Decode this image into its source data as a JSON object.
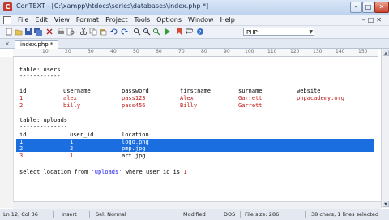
{
  "window": {
    "title": "ConTEXT - [C:\\xampp\\htdocs\\series\\databases\\index.php *]",
    "minimize": "–",
    "maximize": "□",
    "close": "✕"
  },
  "menu": {
    "items": [
      "File",
      "Edit",
      "View",
      "Format",
      "Project",
      "Tools",
      "Options",
      "Window",
      "Help"
    ],
    "right_controls": "–□✕"
  },
  "toolbar": {
    "highlighter": "PHP",
    "icons": [
      "new-file-icon",
      "open-icon",
      "save-icon",
      "save-all-icon",
      "close-file-icon",
      "print-icon",
      "print-preview-icon",
      "cut-icon",
      "copy-icon",
      "paste-icon",
      "undo-icon",
      "redo-icon",
      "find-icon",
      "replace-icon",
      "find-next-icon",
      "run-icon",
      "bookmark-icon",
      "wrap-icon",
      "help-icon"
    ]
  },
  "tabs": [
    {
      "label": "index.php *"
    }
  ],
  "tab_close": "×",
  "ruler": {
    "marks": [
      "10",
      "20",
      "30",
      "40",
      "50",
      "60",
      "70",
      "80",
      "90",
      "100",
      "110",
      "120",
      "130",
      "140",
      "150"
    ]
  },
  "code": {
    "users_title": "table: users",
    "dashes1": "------------",
    "users_headers": [
      "id",
      "username",
      "password",
      "firstname",
      "surname",
      "website"
    ],
    "users_rows": [
      [
        "1",
        "alex",
        "pass123",
        "Alex",
        "Garrett",
        "phpacademy.org"
      ],
      [
        "2",
        "billy",
        "pass456",
        "Billy",
        "Garrett",
        ""
      ]
    ],
    "uploads_title": "table: uploads",
    "dashes2": "--------------",
    "uploads_headers": [
      "id",
      "user_id",
      "location"
    ],
    "uploads_rows": [
      [
        "1",
        "1",
        "logo.png"
      ],
      [
        "2",
        "2",
        "pmp.jpg"
      ],
      [
        "3",
        "1",
        "art.jpg"
      ]
    ],
    "query_prefix": "select location from ",
    "query_table": "'uploads'",
    "query_mid": " where user_id is ",
    "query_value": "1"
  },
  "status": {
    "position": "Ln 12, Col 36",
    "mode": "Insert",
    "sel": "Sel: Normal",
    "modified": "Modified",
    "format": "DOS",
    "size": "File size: 286",
    "chars": "38 chars, 1 lines selected"
  }
}
